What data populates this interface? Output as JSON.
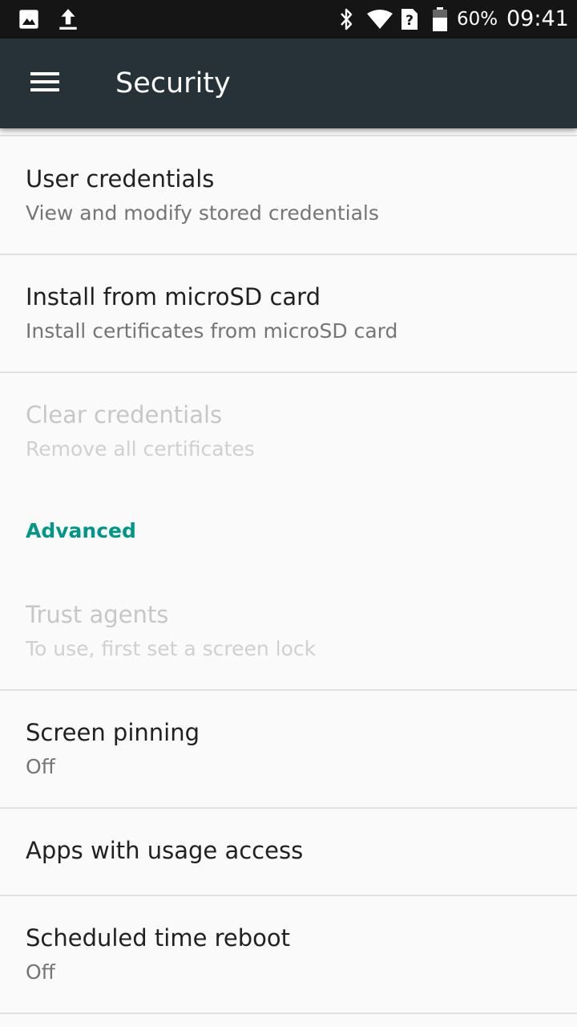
{
  "status_bar": {
    "icons": [
      "image-icon",
      "upload-icon",
      "bluetooth-icon",
      "wifi-icon",
      "sim-unknown-icon",
      "battery-icon"
    ],
    "battery_percent": "60%",
    "time": "09:41"
  },
  "toolbar": {
    "menu_icon": "hamburger-menu-icon",
    "title": "Security"
  },
  "items": [
    {
      "title": "User credentials",
      "summary": "View and modify stored credentials",
      "enabled": true
    },
    {
      "title": "Install from microSD card",
      "summary": "Install certificates from microSD card",
      "enabled": true
    },
    {
      "title": "Clear credentials",
      "summary": "Remove all certificates",
      "enabled": false
    }
  ],
  "advanced_header": "Advanced",
  "advanced_items": [
    {
      "title": "Trust agents",
      "summary": "To use, first set a screen lock",
      "enabled": false
    },
    {
      "title": "Screen pinning",
      "summary": "Off",
      "enabled": true
    },
    {
      "title": "Apps with usage access",
      "enabled": true
    },
    {
      "title": "Scheduled time reboot",
      "summary": "Off",
      "enabled": true
    }
  ],
  "colors": {
    "toolbar": "#263238",
    "status_bar": "#151515",
    "accent": "#009688",
    "background": "#fafafa"
  }
}
